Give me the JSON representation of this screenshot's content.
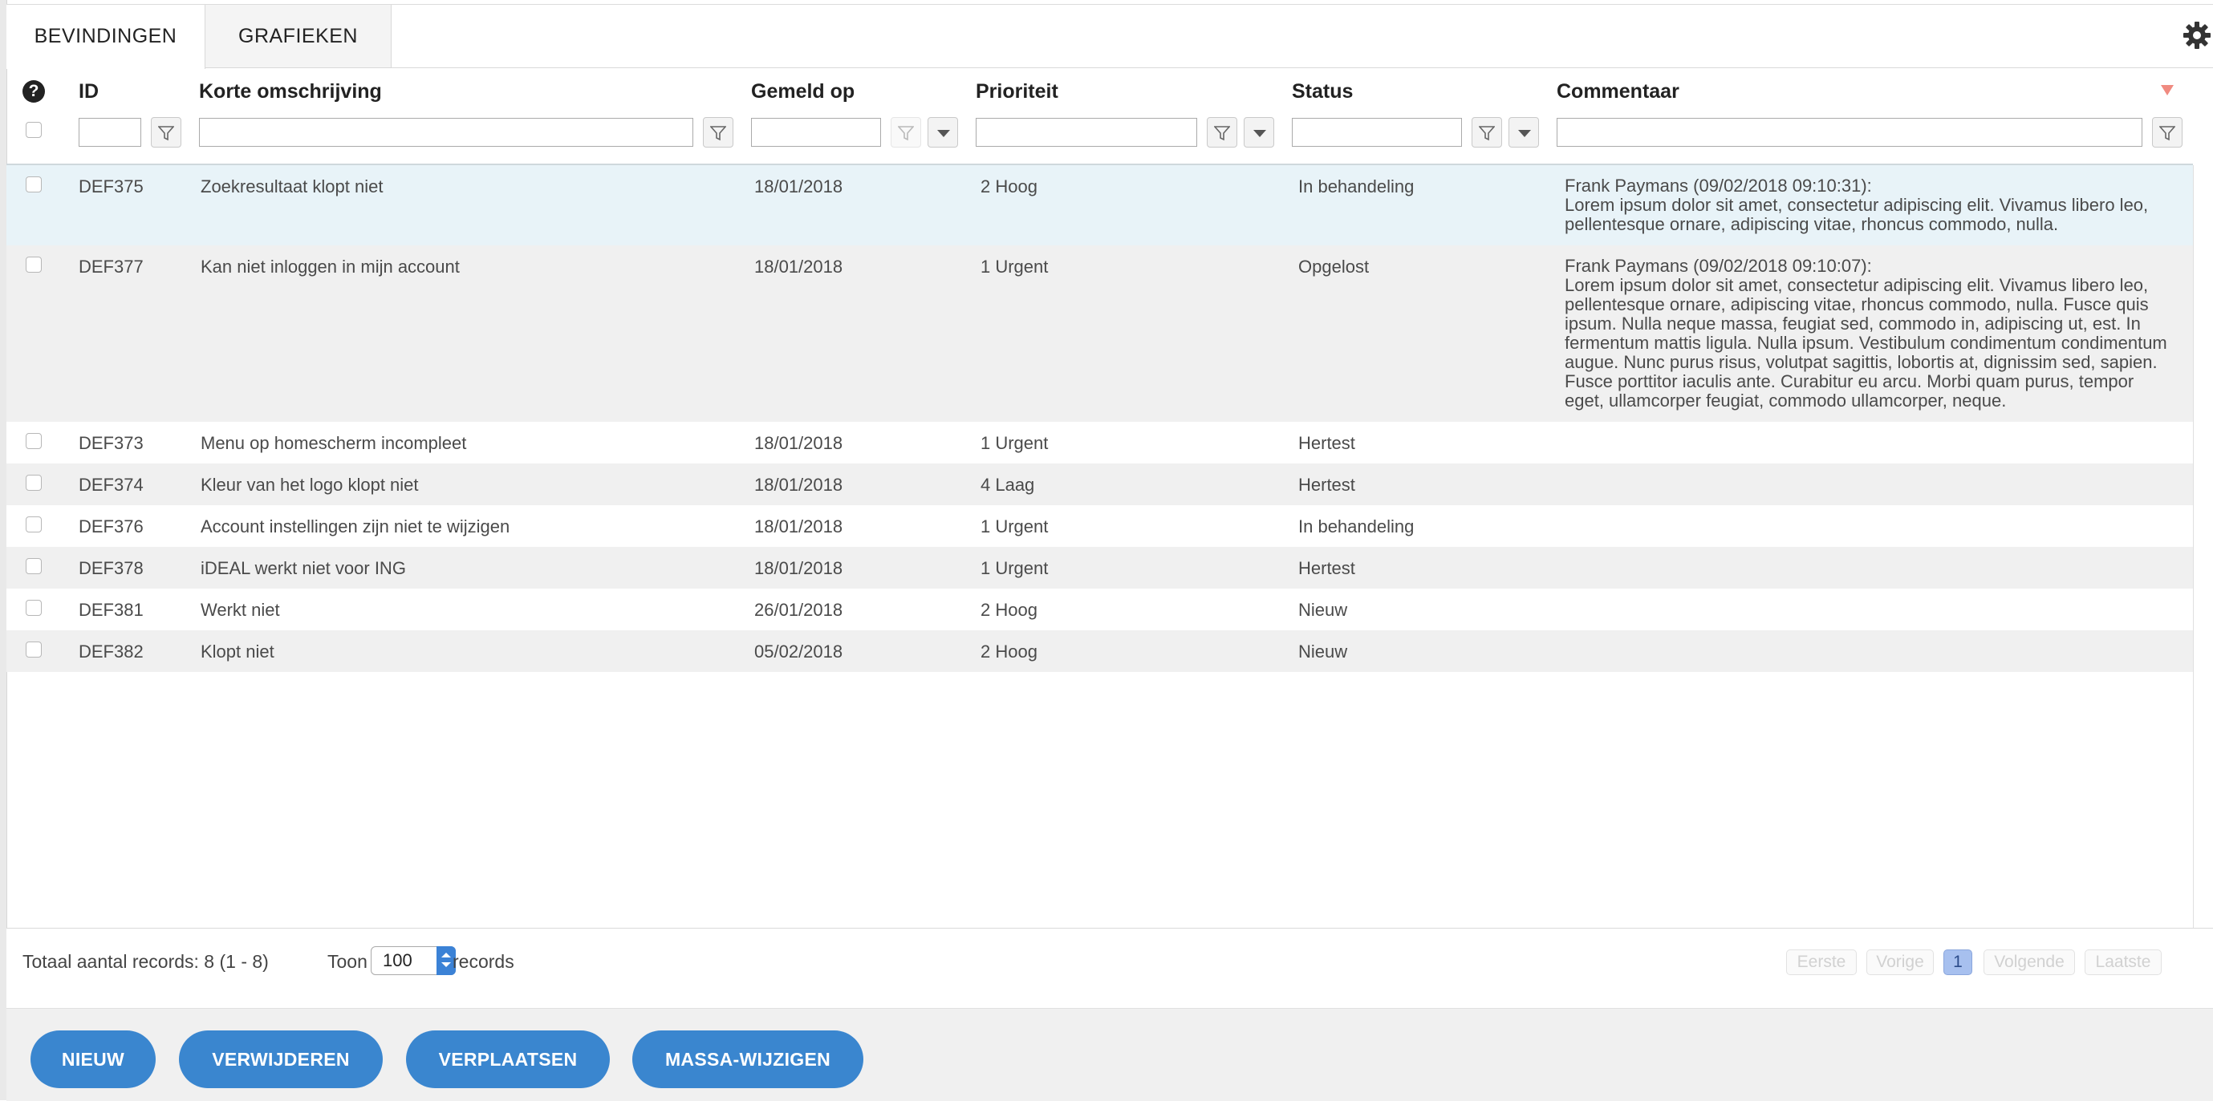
{
  "tabs": [
    {
      "label": "BEVINDINGEN",
      "active": true
    },
    {
      "label": "GRAFIEKEN",
      "active": false
    }
  ],
  "columns": {
    "id": "ID",
    "short_description": "Korte omschrijving",
    "reported_on": "Gemeld op",
    "priority": "Prioriteit",
    "status": "Status",
    "comment": "Commentaar"
  },
  "rows": [
    {
      "id": "DEF375",
      "desc": "Zoekresultaat klopt niet",
      "date": "18/01/2018",
      "priority": "2 Hoog",
      "status": "In behandeling",
      "comment_lines": [
        "Frank Paymans (09/02/2018 09:10:31):",
        "Lorem ipsum dolor sit amet, consectetur adipiscing elit. Vivamus libero leo,",
        "pellentesque ornare, adipiscing vitae, rhoncus commodo, nulla."
      ]
    },
    {
      "id": "DEF377",
      "desc": "Kan niet inloggen in mijn account",
      "date": "18/01/2018",
      "priority": "1 Urgent",
      "status": "Opgelost",
      "comment_lines": [
        "Frank Paymans (09/02/2018 09:10:07):",
        "Lorem ipsum dolor sit amet, consectetur adipiscing elit. Vivamus libero leo,",
        "pellentesque ornare, adipiscing vitae, rhoncus commodo, nulla. Fusce quis",
        "ipsum. Nulla neque massa, feugiat sed, commodo in, adipiscing ut, est. In",
        "fermentum mattis ligula. Nulla ipsum. Vestibulum condimentum condimentum",
        "augue. Nunc purus risus, volutpat sagittis, lobortis at, dignissim sed, sapien.",
        "Fusce porttitor iaculis ante. Curabitur eu arcu. Morbi quam purus, tempor",
        "eget, ullamcorper feugiat, commodo ullamcorper, neque."
      ]
    },
    {
      "id": "DEF373",
      "desc": "Menu op homescherm incompleet",
      "date": "18/01/2018",
      "priority": "1 Urgent",
      "status": "Hertest",
      "comment_lines": []
    },
    {
      "id": "DEF374",
      "desc": "Kleur van het logo klopt niet",
      "date": "18/01/2018",
      "priority": "4 Laag",
      "status": "Hertest",
      "comment_lines": []
    },
    {
      "id": "DEF376",
      "desc": "Account instellingen zijn niet te wijzigen",
      "date": "18/01/2018",
      "priority": "1 Urgent",
      "status": "In behandeling",
      "comment_lines": []
    },
    {
      "id": "DEF378",
      "desc": "iDEAL werkt niet voor ING",
      "date": "18/01/2018",
      "priority": "1 Urgent",
      "status": "Hertest",
      "comment_lines": []
    },
    {
      "id": "DEF381",
      "desc": "Werkt niet",
      "date": "26/01/2018",
      "priority": "2 Hoog",
      "status": "Nieuw",
      "comment_lines": []
    },
    {
      "id": "DEF382",
      "desc": "Klopt niet",
      "date": "05/02/2018",
      "priority": "2 Hoog",
      "status": "Nieuw",
      "comment_lines": []
    }
  ],
  "footer": {
    "total_records": "Totaal aantal records: 8 (1 - 8)",
    "show_label": "Toon",
    "page_size": "100",
    "records_label": "records",
    "pager": {
      "first": "Eerste",
      "prev": "Vorige",
      "current": "1",
      "next": "Volgende",
      "last": "Laatste"
    }
  },
  "actions": {
    "new": "NIEUW",
    "delete": "VERWIJDEREN",
    "move": "VERPLAATSEN",
    "mass_edit": "MASSA-WIJZIGEN"
  },
  "colors": {
    "accent": "#3a86cf",
    "selected_row": "#e8f3f8",
    "alt_row": "#f0f0f0",
    "current_page": "#a7c0ef"
  },
  "icons": [
    "help-icon",
    "gear-icon",
    "filter-icon",
    "sort-desc-icon",
    "dropdown-icon"
  ]
}
